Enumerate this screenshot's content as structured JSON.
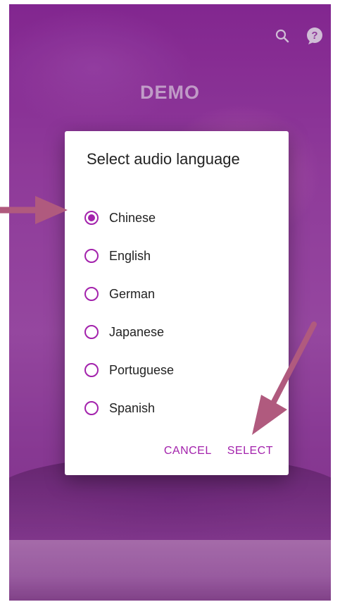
{
  "app": {
    "title": "DEMO"
  },
  "header": {
    "icons": [
      "search-icon",
      "help-icon"
    ]
  },
  "dialog": {
    "title": "Select audio language",
    "selected": "Chinese",
    "options": [
      {
        "label": "Chinese",
        "checked": true
      },
      {
        "label": "English",
        "checked": false
      },
      {
        "label": "German",
        "checked": false
      },
      {
        "label": "Japanese",
        "checked": false
      },
      {
        "label": "Portuguese",
        "checked": false
      },
      {
        "label": "Spanish",
        "checked": false
      }
    ],
    "cancel_label": "CANCEL",
    "select_label": "SELECT"
  },
  "colors": {
    "accent": "#a322ac",
    "annotation_arrow": "#b05a7e",
    "background": "#9d44a8"
  }
}
